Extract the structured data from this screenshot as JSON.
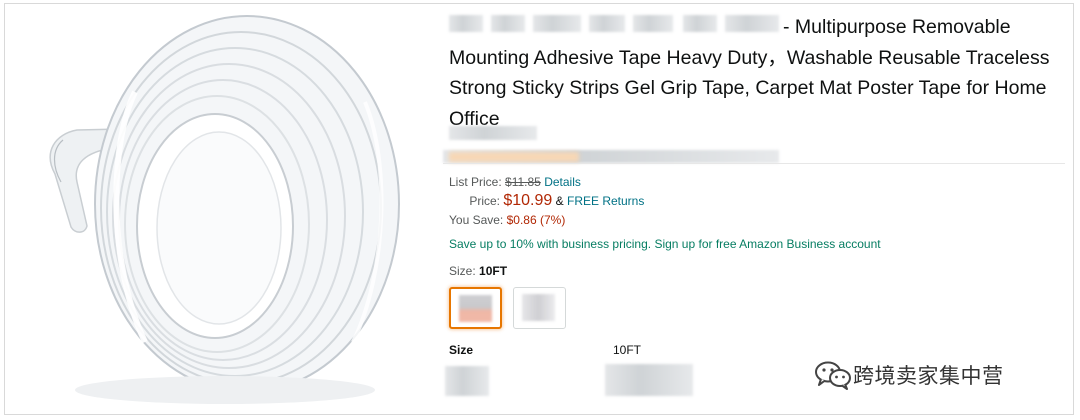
{
  "product": {
    "title": "- Multipurpose Removable Mounting Adhesive Tape Heavy Duty，Washable Reusable Traceless Strong Sticky Strips Gel Grip Tape, Carpet Mat Poster Tape for Home Office"
  },
  "pricing": {
    "list_price_label": "List Price:",
    "list_price": "$11.85",
    "details_link": "Details",
    "price_label": "Price:",
    "price": "$10.99",
    "ampersand": "&",
    "free_returns": "FREE Returns",
    "you_save_label": "You Save:",
    "you_save": "$0.86 (7%)"
  },
  "business_offer": "Save up to 10% with business pricing. Sign up for free Amazon Business account",
  "size": {
    "label": "Size:",
    "selected": "10FT"
  },
  "specs": {
    "label": "Size",
    "value": "10FT"
  },
  "watermark": {
    "text": "跨境卖家集中营",
    "icon": "wechat-icon"
  },
  "colors": {
    "price_red": "#b12704",
    "link_teal": "#007185",
    "business_green": "#067d62",
    "swatch_selected": "#e77600"
  }
}
